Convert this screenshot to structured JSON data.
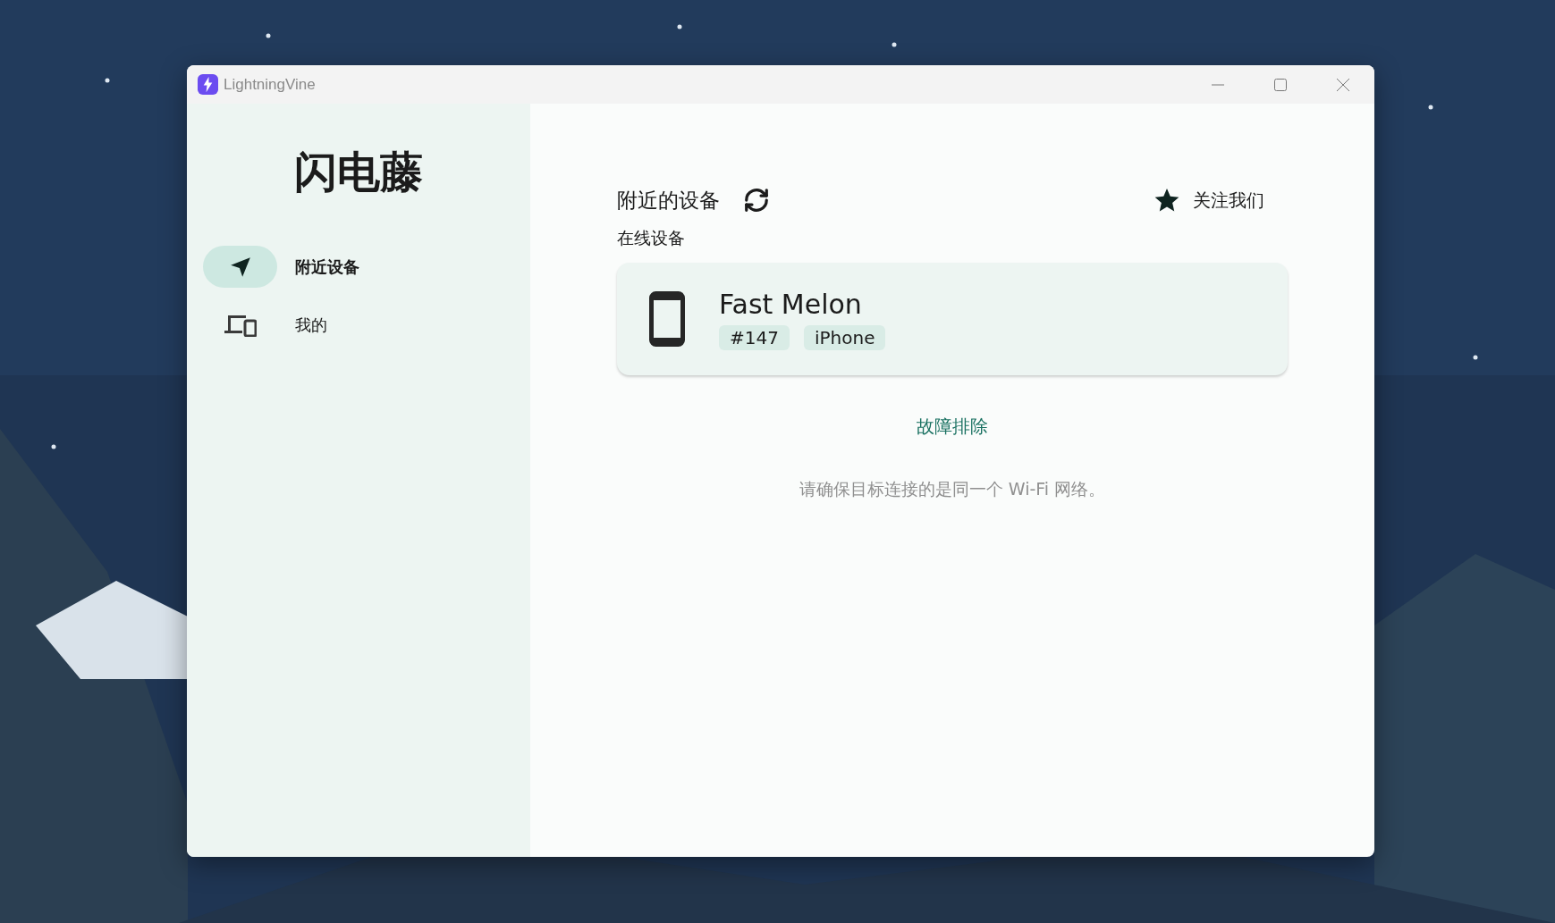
{
  "window": {
    "title": "LightningVine"
  },
  "sidebar": {
    "app_name": "闪电藤",
    "items": [
      {
        "label": "附近设备",
        "kind": "nearby",
        "selected": true
      },
      {
        "label": "我的",
        "kind": "mine",
        "selected": false
      }
    ]
  },
  "main": {
    "heading": "附近的设备",
    "follow_link": "关注我们",
    "section_label": "在线设备",
    "devices": [
      {
        "name": "Fast Melon",
        "tags": [
          "#147",
          "iPhone"
        ]
      }
    ],
    "troubleshoot_link": "故障排除",
    "notice": "请确保目标连接的是同一个 Wi-Fi 网络。"
  }
}
